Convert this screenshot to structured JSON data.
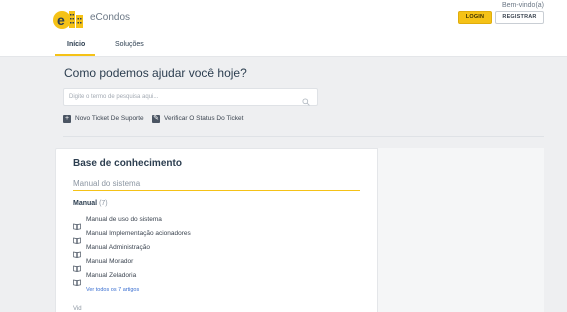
{
  "header": {
    "brand": "eCondos",
    "welcome": "Bem-vindo(a)",
    "login_label": "LOGIN",
    "register_label": "REGISTRAR",
    "accent_color": "#f5c217"
  },
  "tabs": [
    {
      "label": "Início",
      "active": true
    },
    {
      "label": "Soluções",
      "active": false
    }
  ],
  "hero": {
    "title": "Como podemos ajudar você hoje?",
    "search_placeholder": "Digite o termo de pesquisa aqui...",
    "actions": [
      {
        "label": "Novo Ticket De Suporte",
        "icon": "plus-square-icon"
      },
      {
        "label": "Verificar O Status Do Ticket",
        "icon": "ticket-icon"
      }
    ]
  },
  "knowledge_base": {
    "title": "Base de conhecimento",
    "subtitle": "Manual do sistema",
    "section": {
      "title": "Manual",
      "count": "(7)",
      "articles": [
        "Manual de uso do sistema",
        "Manual Implementação acionadores",
        "Manual Administração",
        "Manual Morador",
        "Manual Zeladoria"
      ],
      "see_all": "Ver todos os 7 artigos"
    },
    "next_section_partial": "Vid"
  }
}
